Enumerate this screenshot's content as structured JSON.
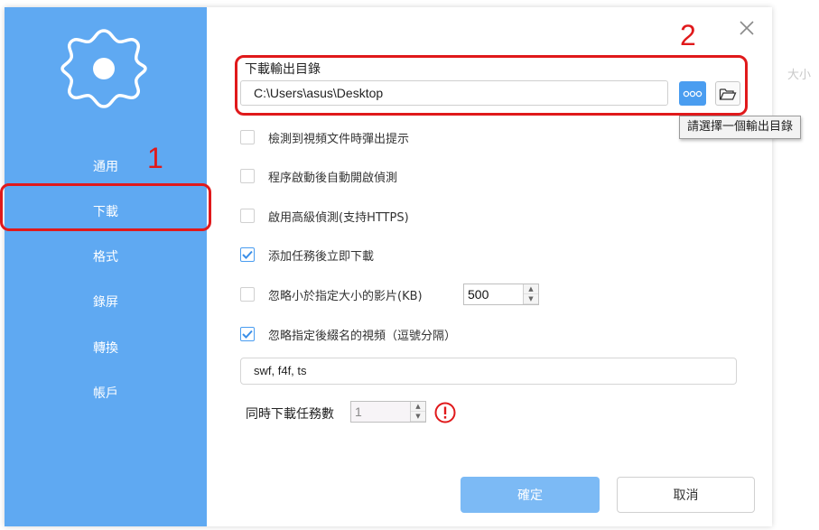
{
  "sidebar": {
    "items": [
      {
        "label": "通用"
      },
      {
        "label": "下載"
      },
      {
        "label": "格式"
      },
      {
        "label": "錄屏"
      },
      {
        "label": "轉換"
      },
      {
        "label": "帳戶"
      }
    ],
    "active_index": 1,
    "background": "#5fa9f2"
  },
  "annotations": {
    "marker_1": "1",
    "marker_2": "2",
    "color": "#e0191b"
  },
  "ghost_text": "大小",
  "download": {
    "section_title": "下載輸出目錄",
    "path_value": "C:\\Users\\asus\\Desktop",
    "tooltip": "請選擇一個輸出目錄"
  },
  "options": [
    {
      "label": "檢測到視頻文件時彈出提示",
      "checked": false
    },
    {
      "label": "程序啟動後自動開啟偵測",
      "checked": false
    },
    {
      "label": "啟用高級偵測(支持HTTPS)",
      "checked": false
    },
    {
      "label": "添加任務後立即下載",
      "checked": true
    },
    {
      "label": "忽略小於指定大小的影片(KB)",
      "checked": false
    },
    {
      "label": "忽略指定後綴名的視頻（逗號分隔）",
      "checked": true
    }
  ],
  "min_size_value": "500",
  "extensions_value": "swf, f4f, ts",
  "concurrent": {
    "label": "同時下載任務數",
    "value": "1"
  },
  "buttons": {
    "ok": "確定",
    "cancel": "取消"
  },
  "icons": {
    "settings": "gear-icon",
    "close": "close-icon",
    "more": "more-dots-icon",
    "folder": "folder-open-icon",
    "check": "checkmark-icon",
    "warning": "exclamation-circle-icon"
  }
}
